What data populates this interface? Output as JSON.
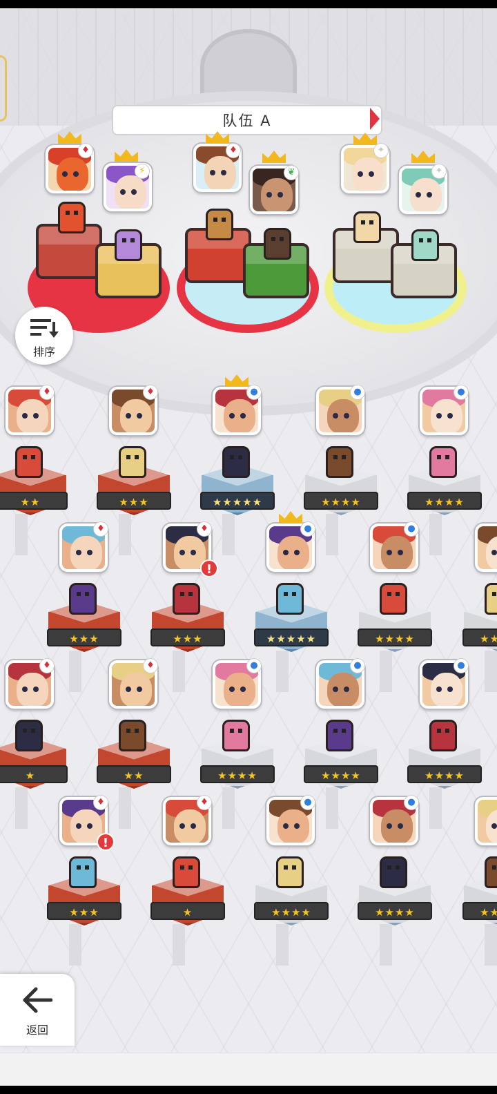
{
  "team": {
    "title": "队伍 A"
  },
  "controls": {
    "sort_label": "排序",
    "back_label": "返回"
  },
  "colors": {
    "fire_platform": "#e73445",
    "water_platform": "#bfeaf5",
    "light_platform": "#f0f08c",
    "star_gold": "#f4c51d"
  },
  "team_slots": [
    {
      "name": "fire-dragon",
      "badge": "card-red",
      "crowned": true
    },
    {
      "name": "purple-hair-girl",
      "badge": "lightning-yellow",
      "crowned": true
    },
    {
      "name": "brown-hair-boy",
      "badge": "card-red",
      "crowned": true
    },
    {
      "name": "dark-hair-man",
      "badge": "leaf-green",
      "crowned": true
    },
    {
      "name": "blonde-elf",
      "badge": "sparkle-white",
      "crowned": true
    },
    {
      "name": "teal-hair-girl",
      "badge": "sparkle-white",
      "crowned": true
    }
  ],
  "roster": [
    {
      "row": 1,
      "stars": "★★",
      "element": "fire",
      "badge": "card-red"
    },
    {
      "row": 1,
      "stars": "★★★",
      "element": "fire",
      "badge": "card-red"
    },
    {
      "row": 1,
      "stars": "★★★★★",
      "element": "water",
      "badge": "blue-dot",
      "crowned": true
    },
    {
      "row": 1,
      "stars": "★★★★",
      "element": "basic",
      "badge": "blue-dot"
    },
    {
      "row": 1,
      "stars": "★★★★",
      "element": "basic",
      "badge": "blue-dot"
    },
    {
      "row": 2,
      "stars": "★★★",
      "element": "fire",
      "badge": "card-red"
    },
    {
      "row": 2,
      "stars": "★★★",
      "element": "fire",
      "badge": "card-red",
      "alert": "!"
    },
    {
      "row": 2,
      "stars": "★★★★★",
      "element": "water",
      "badge": "blue-dot",
      "crowned": true
    },
    {
      "row": 2,
      "stars": "★★★★",
      "element": "basic",
      "badge": "blue-dot"
    },
    {
      "row": 2,
      "stars": "★★★★",
      "element": "basic",
      "badge": "blue-dot"
    },
    {
      "row": 3,
      "stars": "★",
      "element": "fire",
      "badge": "card-red"
    },
    {
      "row": 3,
      "stars": "★★",
      "element": "fire",
      "badge": "card-red"
    },
    {
      "row": 3,
      "stars": "★★★★",
      "element": "basic",
      "badge": "blue-dot"
    },
    {
      "row": 3,
      "stars": "★★★★",
      "element": "basic",
      "badge": "blue-dot"
    },
    {
      "row": 3,
      "stars": "★★★★",
      "element": "basic",
      "badge": "blue-dot"
    },
    {
      "row": 4,
      "stars": "★★★",
      "element": "fire",
      "badge": "card-red",
      "alert": "!"
    },
    {
      "row": 4,
      "stars": "★",
      "element": "fire",
      "badge": "card-red"
    },
    {
      "row": 4,
      "stars": "★★★★",
      "element": "basic",
      "badge": "blue-dot"
    },
    {
      "row": 4,
      "stars": "★★★★",
      "element": "basic",
      "badge": "blue-dot"
    },
    {
      "row": 4,
      "stars": "★★★★",
      "element": "basic",
      "badge": "blue-dot"
    }
  ]
}
